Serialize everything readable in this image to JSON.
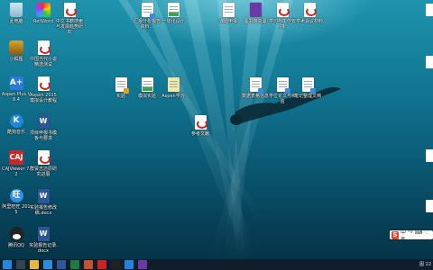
{
  "desktop": {
    "icons": {
      "recycle": "此电脑",
      "reliword": "ReliWord",
      "pdf_top": "中文书籍搜索与发展趋势研究",
      "doc_top1": "汇报分析报告资料…",
      "doc_top2": "一体化设计",
      "doc_top3": "课题申报",
      "doc_top4": "图书馆资源",
      "doc_top5": "学习与工作安排",
      "doc_top6": "学术会议材料",
      "fox": "小狐狸",
      "pdf_left2": "中国当代小说精选测试",
      "aspen": "Aspen Plus V8.4",
      "pdf_left3": "Aspen 2015模拟设计教程",
      "doc_mid1": "实验",
      "doc_mid2": "模拟实验",
      "doc_mid3": "Aspen学习",
      "doc_mid4": "数据表格信息",
      "doc_mid5": "学位论文与实验",
      "doc_mid6": "笔记整理文档",
      "doc_pdf_mid": "参考文献",
      "kugou": "酷狗音乐",
      "word_left": "项目申报书模板与要求",
      "cad": "CAJViewer 7.2",
      "pdf_left5": "群贤志还原研究进展",
      "ali": "阿里旺旺 2015",
      "word_left2": "实验报告修改稿.docx",
      "qq": "腾讯QQ",
      "word_left3": "实验报告记录.docx"
    }
  },
  "ime": {
    "icon": "S",
    "text": "中 °º ⌨ ♡ ≣"
  },
  "taskbar": {
    "time": "图 22"
  }
}
